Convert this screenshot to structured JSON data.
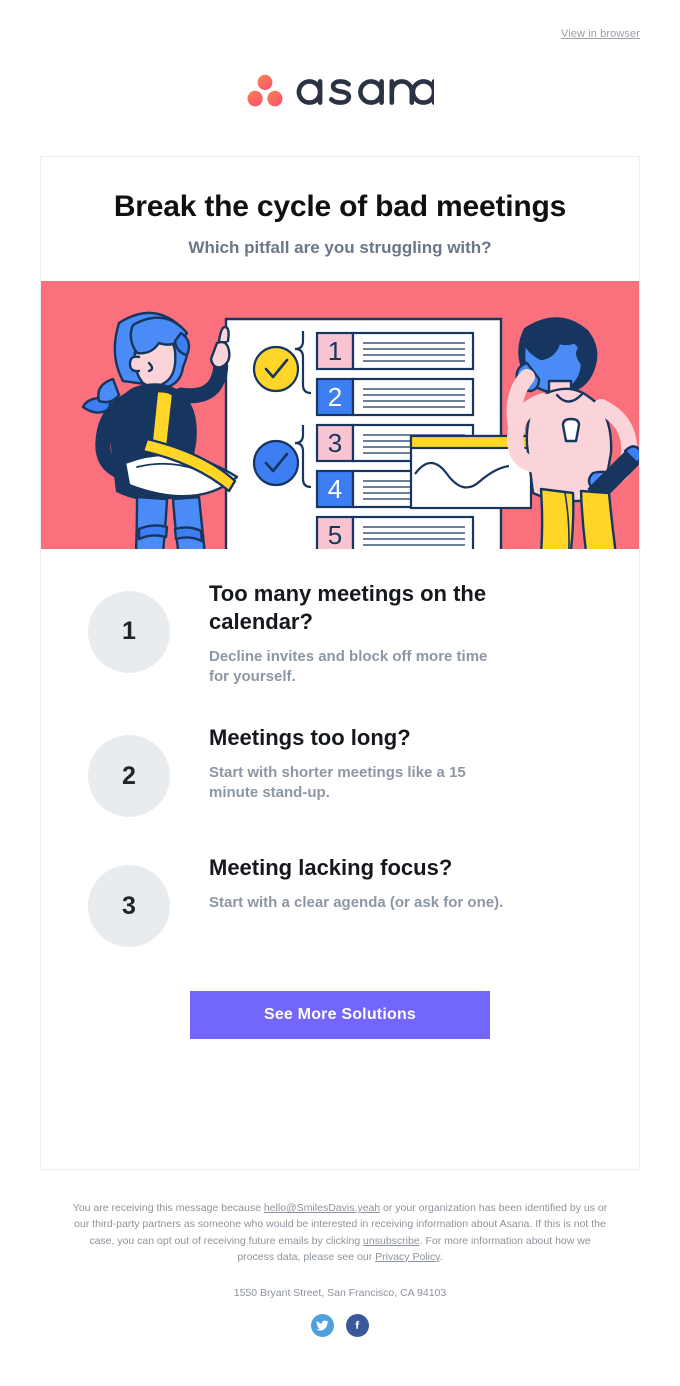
{
  "preheader": {
    "view_in_browser": "View in browser"
  },
  "brand": {
    "name": "asana",
    "logo_dot_color_start": "#fb8b5a",
    "logo_dot_color_end": "#f9556c",
    "wordmark_color": "#2b3243"
  },
  "card": {
    "headline": "Break the cycle of bad meetings",
    "subhead": "Which pitfall are you struggling with?"
  },
  "hero": {
    "alt": "Two coworkers reviewing a numbered meeting checklist",
    "background_color": "#fb707d",
    "checklist_numbers": [
      "1",
      "2",
      "3",
      "4",
      "5"
    ],
    "accent_yellow": "#ffd628",
    "accent_blue": "#3d7ff2",
    "accent_pink": "#f9c4d2",
    "outline_navy": "#16365f"
  },
  "items": [
    {
      "number": "1",
      "title": "Too many meetings on the calendar?",
      "desc": "Decline invites and block off more time for yourself."
    },
    {
      "number": "2",
      "title": "Meetings too long?",
      "desc": "Start with shorter meetings like a 15 minute stand-up."
    },
    {
      "number": "3",
      "title": "Meeting lacking focus?",
      "desc": "Start with a clear agenda (or ask for one)."
    }
  ],
  "cta": {
    "label": "See More Solutions",
    "color": "#7366fb"
  },
  "footer": {
    "legal_part1": "You are receiving this message because ",
    "email_link": "hello@SmilesDavis.yeah",
    "legal_part2": " or your organization has been identified by us or our third-party partners as someone who would be interested in receiving information about Asana. If this is not the case, you can opt out of receiving future emails by clicking ",
    "unsubscribe_link": "unsubscribe",
    "legal_part3": ". For more information about how we process data, please see our ",
    "privacy_link": "Privacy Policy",
    "legal_part4": ".",
    "address": "1550 Bryant Street, San Francisco, CA 94103",
    "social": [
      {
        "name": "twitter",
        "color": "#4da2dd"
      },
      {
        "name": "facebook",
        "color": "#3b5998"
      }
    ]
  }
}
